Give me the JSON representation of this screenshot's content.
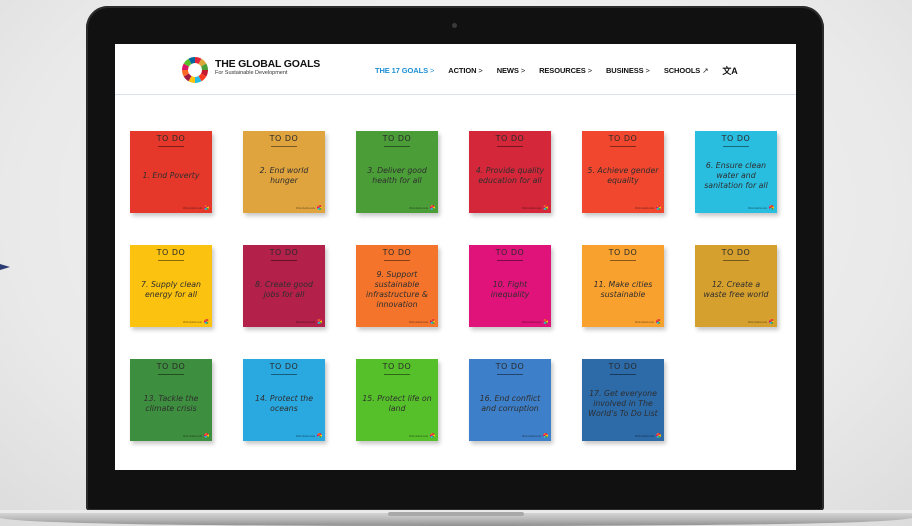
{
  "window": {
    "brand_title": "THE GLOBAL GOALS",
    "brand_subtitle": "For Sustainable Development"
  },
  "nav": {
    "items": [
      {
        "label": "THE 17 GOALS",
        "chevron": ">",
        "active": true
      },
      {
        "label": "ACTION",
        "chevron": ">",
        "active": false
      },
      {
        "label": "NEWS",
        "chevron": ">",
        "active": false
      },
      {
        "label": "RESOURCES",
        "chevron": ">",
        "active": false
      },
      {
        "label": "BUSINESS",
        "chevron": ">",
        "active": false
      },
      {
        "label": "SCHOOLS",
        "chevron": "↗",
        "active": false
      }
    ],
    "language_icon": "translate-icon",
    "language_label": "A"
  },
  "notes": [
    {
      "head": "TO DO",
      "text": "1. End Poverty",
      "color": "#e5382b",
      "footer": "#GlobalGoals"
    },
    {
      "head": "TO DO",
      "text": "2. End world hunger",
      "color": "#e0a43f",
      "footer": "#GlobalGoals"
    },
    {
      "head": "TO DO",
      "text": "3. Deliver good health for all",
      "color": "#4b9d38",
      "footer": "#GlobalGoals"
    },
    {
      "head": "TO DO",
      "text": "4. Provide quality education for all",
      "color": "#d4283a",
      "footer": "#GlobalGoals"
    },
    {
      "head": "TO DO",
      "text": "5. Achieve gender equality",
      "color": "#f1472e",
      "footer": "#GlobalGoals"
    },
    {
      "head": "TO DO",
      "text": "6. Ensure clean water and sanitation for all",
      "color": "#29bde0",
      "footer": "#GlobalGoals"
    },
    {
      "head": "TO DO",
      "text": "7. Supply clean energy for all",
      "color": "#fbc20f",
      "footer": "#GlobalGoals"
    },
    {
      "head": "TO DO",
      "text": "8. Create good jobs for all",
      "color": "#b3204a",
      "footer": "#GlobalGoals"
    },
    {
      "head": "TO DO",
      "text": "9. Support sustainable infrastructure & innovation",
      "color": "#f4742c",
      "footer": "#GlobalGoals"
    },
    {
      "head": "TO DO",
      "text": "10. Fight inequality",
      "color": "#e0137a",
      "footer": "#GlobalGoals"
    },
    {
      "head": "TO DO",
      "text": "11. Make cities sustainable",
      "color": "#f9a12e",
      "footer": "#GlobalGoals"
    },
    {
      "head": "TO DO",
      "text": "12. Create a waste free world",
      "color": "#d6a02e",
      "footer": "#GlobalGoals"
    },
    {
      "head": "TO DO",
      "text": "13. Tackle the climate crisis",
      "color": "#3e8e3f",
      "footer": "#GlobalGoals"
    },
    {
      "head": "TO DO",
      "text": "14. Protect the oceans",
      "color": "#2aa8e0",
      "footer": "#GlobalGoals"
    },
    {
      "head": "TO DO",
      "text": "15. Protect life on land",
      "color": "#56c02b",
      "footer": "#GlobalGoals"
    },
    {
      "head": "TO DO",
      "text": "16. End conflict and corruption",
      "color": "#3d7fc8",
      "footer": "#GlobalGoals"
    },
    {
      "head": "TO DO",
      "text": "17. Get everyone involved in The World's To Do List",
      "color": "#2c6aa8",
      "footer": "#GlobalGoals"
    }
  ]
}
